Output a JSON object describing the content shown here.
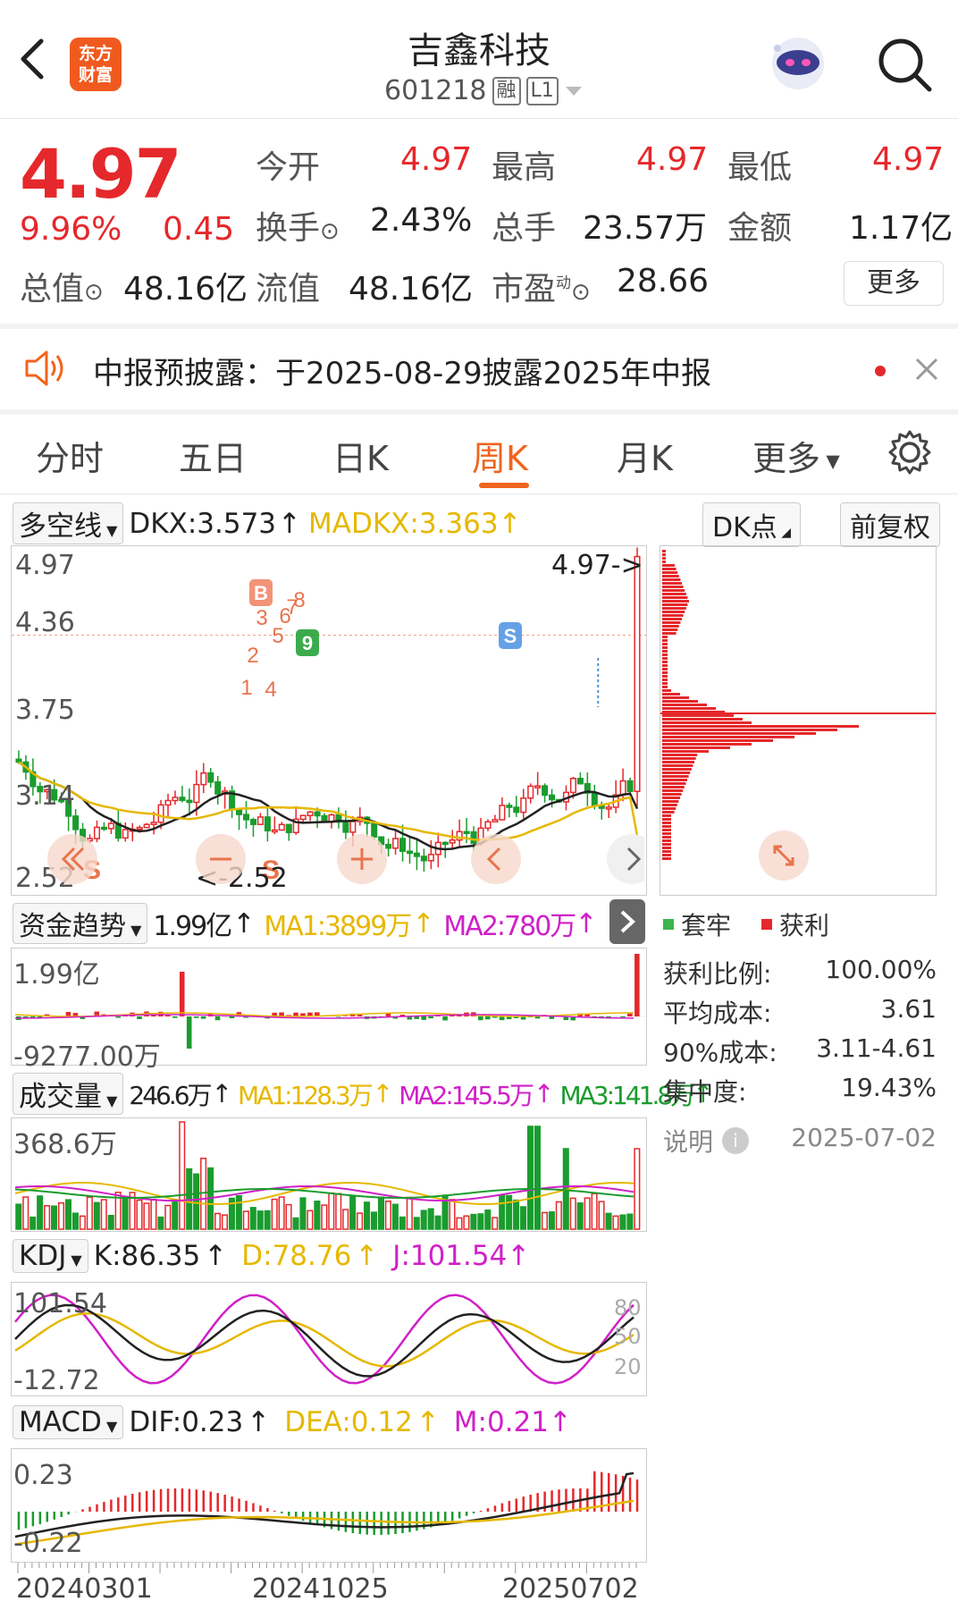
{
  "header": {
    "logo_text": "东方财富",
    "title": "吉鑫科技",
    "code": "601218",
    "badge_rong": "融",
    "badge_level": "L1"
  },
  "quote": {
    "price": "4.97",
    "pct": "9.96%",
    "change": "0.45",
    "open_label": "今开",
    "open": "4.97",
    "high_label": "最高",
    "high": "4.97",
    "low_label": "最低",
    "low": "4.97",
    "turnover_label": "换手",
    "turnover": "2.43%",
    "volume_label": "总手",
    "volume": "23.57万",
    "amount_label": "金额",
    "amount": "1.17亿",
    "mktcap_label": "总值",
    "mktcap": "48.16亿",
    "float_label": "流值",
    "float": "48.16亿",
    "pe_label": "市盈",
    "pe_sup": "动",
    "pe": "28.66",
    "more": "更多"
  },
  "notice": {
    "text": "中报预披露：于2025-08-29披露2025年中报"
  },
  "tabs": [
    "分时",
    "五日",
    "日K",
    "周K",
    "月K",
    "更多"
  ],
  "active_tab": 3,
  "main_chart": {
    "indicator": "多空线",
    "dkx": "DKX:3.573",
    "madkx": "MADKX:3.363",
    "dk_btn": "DK点",
    "fq_btn": "前复权",
    "y_labels": [
      "4.97",
      "4.36",
      "3.75",
      "3.14",
      "2.52"
    ],
    "max_note": "4.97->",
    "min_note": "<-2.52",
    "markers": [
      "B",
      "S",
      "S",
      "S",
      "1",
      "2",
      "3",
      "4",
      "5",
      "6",
      "7",
      "8",
      "9"
    ]
  },
  "fund": {
    "indicator": "资金趋势",
    "value": "1.99亿",
    "ma1": "MA1:3899万",
    "ma2": "MA2:780万",
    "y_top": "1.99亿",
    "y_bottom": "-9277.00万"
  },
  "vol": {
    "indicator": "成交量",
    "value": "246.6万",
    "ma1": "MA1:128.3万",
    "ma2": "MA2:145.5万",
    "ma3": "MA3:141.8万",
    "y_top": "368.6万"
  },
  "kdj": {
    "indicator": "KDJ",
    "k": "K:86.35",
    "d": "D:78.76",
    "j": "J:101.54",
    "y_top": "101.54",
    "y_bottom": "-12.72",
    "lvl80": "80",
    "lvl50": "50",
    "lvl20": "20"
  },
  "macd": {
    "indicator": "MACD",
    "dif": "DIF:0.23",
    "dea": "DEA:0.12",
    "m": "M:0.21",
    "y_top": "0.23",
    "y_bottom": "-0.22"
  },
  "x_axis": [
    "20240301",
    "20241025",
    "20250702"
  ],
  "chip": {
    "legend_trap": "套牢",
    "legend_profit": "获利",
    "rows": [
      {
        "label": "获利比例:",
        "value": "100.00%"
      },
      {
        "label": "平均成本:",
        "value": "3.61"
      },
      {
        "label": "90%成本:",
        "value": "3.11-4.61"
      },
      {
        "label": "集中度:",
        "value": "19.43%"
      }
    ],
    "note_label": "说明",
    "date": "2025-07-02"
  },
  "colors": {
    "up": "#e5282b",
    "down": "#1a9c2e",
    "accent": "#f0641e",
    "yellow": "#e6b800",
    "magenta": "#d020c8"
  }
}
